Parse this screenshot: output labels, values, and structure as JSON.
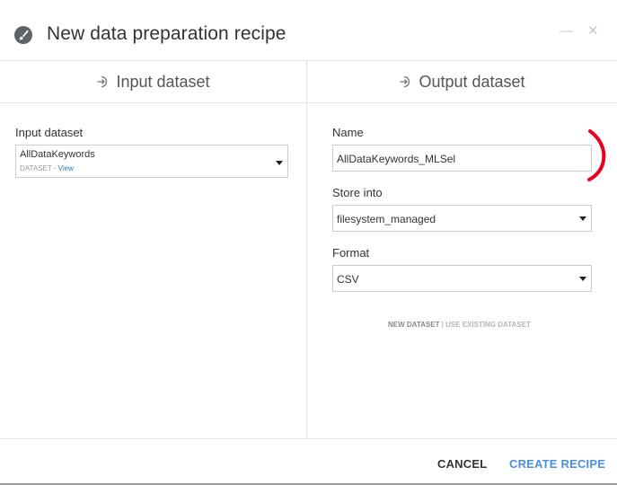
{
  "dialog": {
    "title": "New data preparation recipe",
    "minimize_icon": "minimize-icon",
    "close_icon": "close-icon"
  },
  "input_section": {
    "header": "Input dataset",
    "field_label": "Input dataset",
    "selected_name": "AllDataKeywords",
    "type_label": "DATASET",
    "separator": " - ",
    "view_link": "View"
  },
  "output_section": {
    "header": "Output dataset",
    "name_label": "Name",
    "name_value": "AllDataKeywords_MLSel",
    "store_label": "Store into",
    "store_value": "filesystem_managed",
    "format_label": "Format",
    "format_value": "CSV",
    "new_dataset": "NEW DATASET",
    "toggle_separator": " | ",
    "use_existing": "USE EXISTING DATASET"
  },
  "footer": {
    "cancel": "CANCEL",
    "create": "CREATE RECIPE"
  },
  "colors": {
    "accent": "#4a90e2",
    "annotation": "#e8001c"
  }
}
